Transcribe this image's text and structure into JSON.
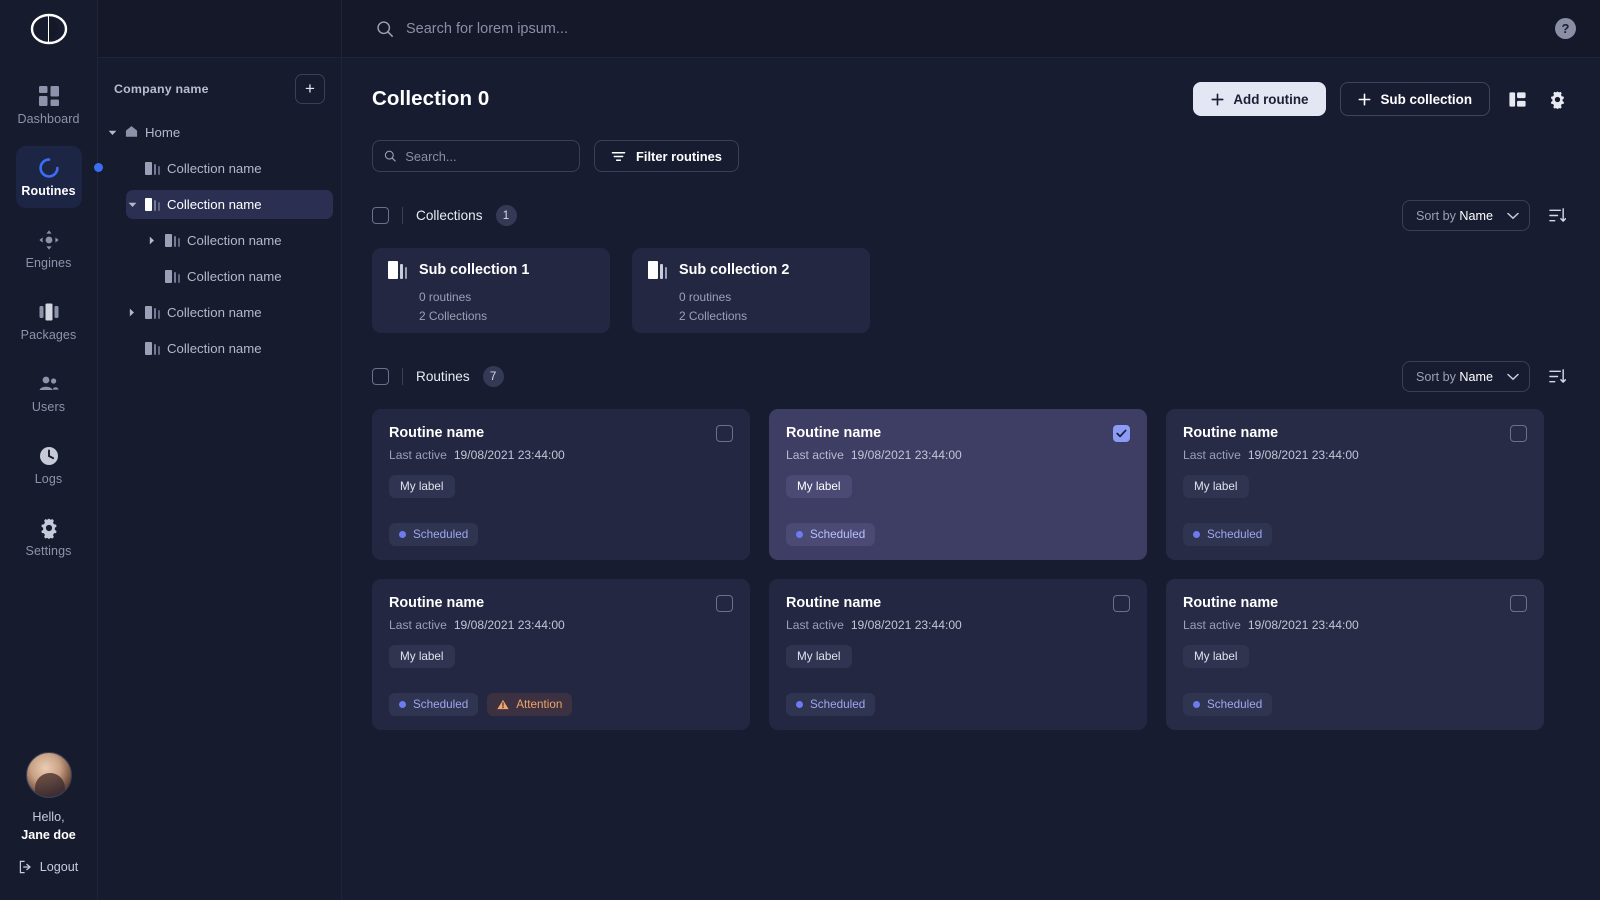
{
  "brand": {
    "logo_name": "app-logo"
  },
  "colors": {
    "accent_blue": "#3b6ef3",
    "selected_card": "#3e3d64",
    "card_bg": "#232741",
    "page_bg": "#181c31",
    "panel_bg": "#171b2e",
    "scheduled_text": "#9da7f0",
    "attention_text": "#f0a36b"
  },
  "topbar": {
    "search_placeholder": "Search for lorem ipsum...",
    "search_value": "",
    "help_label": "?"
  },
  "rail": {
    "items": [
      {
        "label": "Dashboard",
        "icon": "dashboard-icon",
        "active": false
      },
      {
        "label": "Routines",
        "icon": "routines-icon",
        "active": true
      },
      {
        "label": "Engines",
        "icon": "engines-icon",
        "active": false
      },
      {
        "label": "Packages",
        "icon": "packages-icon",
        "active": false
      },
      {
        "label": "Users",
        "icon": "users-icon",
        "active": false
      },
      {
        "label": "Logs",
        "icon": "logs-icon",
        "active": false
      },
      {
        "label": "Settings",
        "icon": "settings-icon",
        "active": false
      }
    ],
    "user": {
      "greeting": "Hello,",
      "name": "Jane doe",
      "logout_label": "Logout"
    }
  },
  "tree": {
    "company": "Company name",
    "add_label": "+",
    "items": [
      {
        "label": "Home",
        "depth": 0,
        "icon": "home-icon",
        "caret": "down",
        "selected": false
      },
      {
        "label": "Collection name",
        "depth": 1,
        "icon": "collection-icon",
        "caret": "none",
        "selected": false
      },
      {
        "label": "Collection name",
        "depth": 1,
        "icon": "collection-icon",
        "caret": "down",
        "selected": true
      },
      {
        "label": "Collection name",
        "depth": 2,
        "icon": "collection-icon",
        "caret": "right",
        "selected": false
      },
      {
        "label": "Collection name",
        "depth": 2,
        "icon": "collection-icon",
        "caret": "none",
        "selected": false
      },
      {
        "label": "Collection name",
        "depth": 1,
        "icon": "collection-icon",
        "caret": "right",
        "selected": false
      },
      {
        "label": "Collection name",
        "depth": 1,
        "icon": "collection-icon",
        "caret": "none",
        "selected": false
      }
    ]
  },
  "page": {
    "title": "Collection 0",
    "actions": {
      "add_routine": "Add routine",
      "sub_collection": "Sub collection",
      "layout_icon": "layout-toggle-icon",
      "settings_icon": "gear-icon"
    },
    "toolbar": {
      "search_placeholder": "Search...",
      "search_value": "",
      "filter_label": "Filter routines"
    }
  },
  "collections_section": {
    "title": "Collections",
    "count": "1",
    "sort_prefix": "Sort by ",
    "sort_value": "Name",
    "order_icon": "sort-order-icon",
    "cards": [
      {
        "title": "Sub collection 1",
        "routines": "0 routines",
        "collections": "2 Collections"
      },
      {
        "title": "Sub collection 2",
        "routines": "0 routines",
        "collections": "2 Collections"
      }
    ]
  },
  "routines_section": {
    "title": "Routines",
    "count": "7",
    "sort_prefix": "Sort by ",
    "sort_value": "Name",
    "order_icon": "sort-order-icon",
    "last_active_label": "Last active",
    "cards": [
      {
        "name": "Routine name",
        "date": "19/08/2021 23:44:00",
        "label": "My label",
        "status": "Scheduled",
        "warning": null,
        "selected": false,
        "variant": "base"
      },
      {
        "name": "Routine name",
        "date": "19/08/2021 23:44:00",
        "label": "My label",
        "status": "Scheduled",
        "warning": null,
        "selected": true,
        "variant": "base"
      },
      {
        "name": "Routine name",
        "date": "19/08/2021 23:44:00",
        "label": "My label",
        "status": "Scheduled",
        "warning": null,
        "selected": false,
        "variant": "alt"
      },
      {
        "name": "Routine name",
        "date": "19/08/2021 23:44:00",
        "label": "My label",
        "status": "Scheduled",
        "warning": "Attention",
        "selected": false,
        "variant": "base"
      },
      {
        "name": "Routine name",
        "date": "19/08/2021 23:44:00",
        "label": "My label",
        "status": "Scheduled",
        "warning": null,
        "selected": false,
        "variant": "base"
      },
      {
        "name": "Routine name",
        "date": "19/08/2021 23:44:00",
        "label": "My label",
        "status": "Scheduled",
        "warning": null,
        "selected": false,
        "variant": "alt"
      }
    ]
  }
}
